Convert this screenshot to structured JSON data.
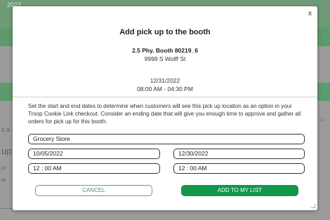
{
  "background": {
    "header_text": "2022",
    "fragments": [
      "s a",
      "up",
      "ur",
      "ot",
      "ch"
    ]
  },
  "modal": {
    "close_label": "x",
    "title": "Add pick up to the booth",
    "booth_name": "2.5 Phy. Booth 80219_6",
    "booth_address": "9999 S Wolff St",
    "date": "12/31/2022",
    "time_range": "08:00 AM - 04:30 PM",
    "description": "Set the start and end dates to determine when customers will see this pick up location as an option in your Troop Cookie Link checkout. Consider an ending date that will give you enough time to approve and gather all orders for pick up for this booth.",
    "fields": {
      "location": "Grocery Store",
      "start_date": "10/05/2022",
      "end_date": "12/30/2022",
      "start_time": "12 : 00  AM",
      "end_time": "12 : 00  AM"
    },
    "buttons": {
      "cancel": "CANCEL",
      "add": "ADD TO MY LIST"
    }
  },
  "colors": {
    "primary_green": "#13964a",
    "cancel_outline": "#5da77a",
    "overlay": "#9b9b9b"
  }
}
